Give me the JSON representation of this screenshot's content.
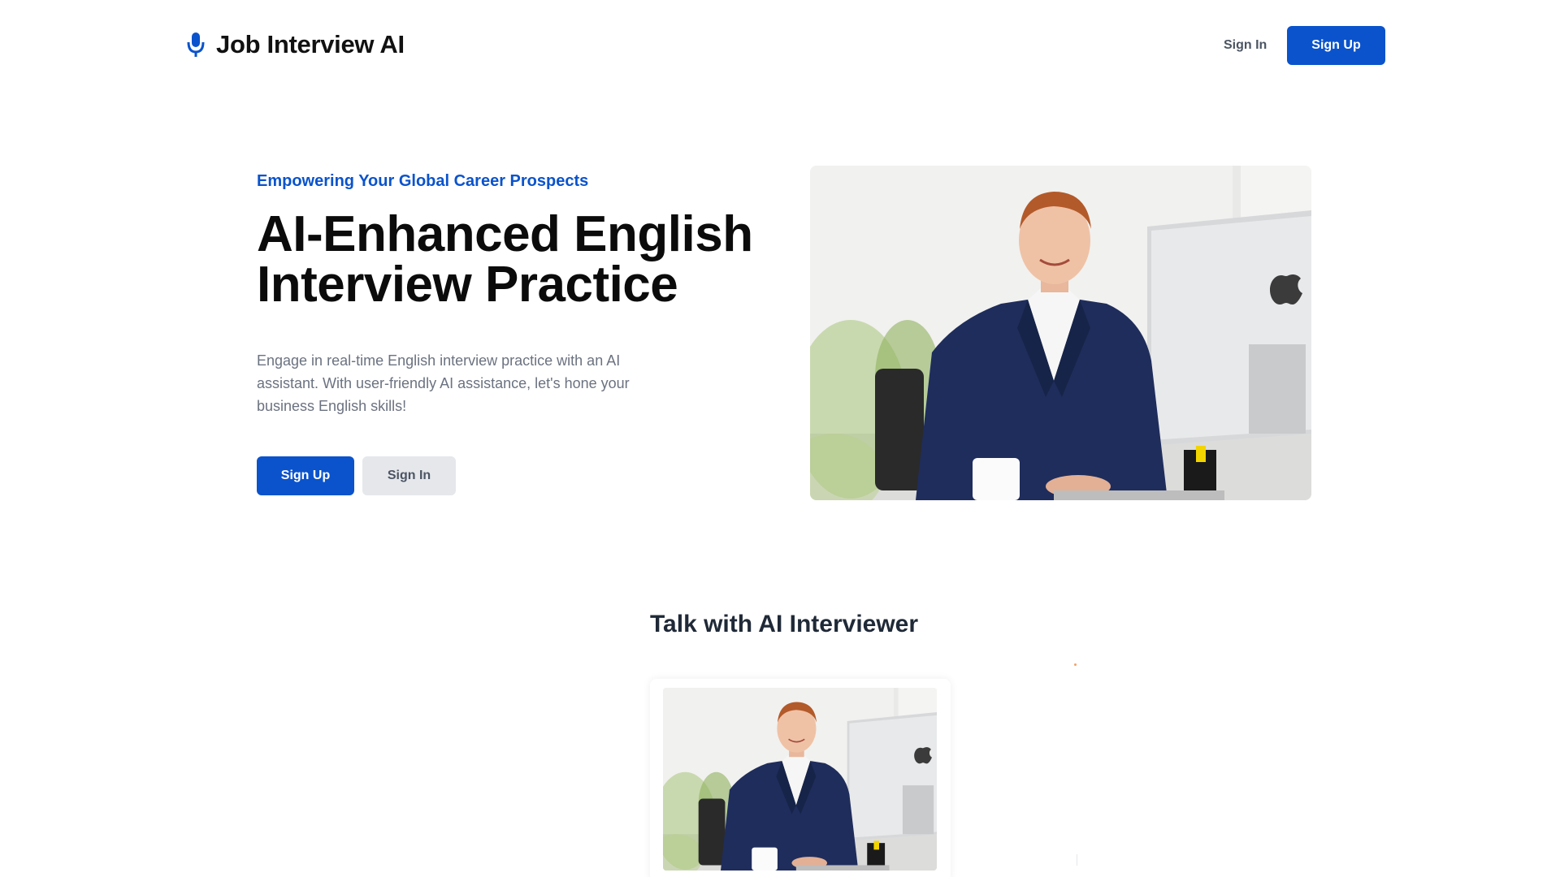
{
  "app": {
    "name": "Job Interview AI",
    "icon": "microphone-icon",
    "accent_color": "#0a53cc"
  },
  "nav": {
    "signin_label": "Sign In",
    "signup_label": "Sign Up"
  },
  "hero": {
    "eyebrow": "Empowering Your Global Career Prospects",
    "title": "AI-Enhanced English Interview Practice",
    "description": "Engage in real-time English interview practice with an AI assistant. With user-friendly AI assistance, let's hone your business English skills!",
    "signup_label": "Sign Up",
    "signin_label": "Sign In",
    "image": "businessman-at-desk-photo"
  },
  "interviewer_section": {
    "title": "Talk with AI Interviewer",
    "card_image": "interviewer-photo"
  }
}
